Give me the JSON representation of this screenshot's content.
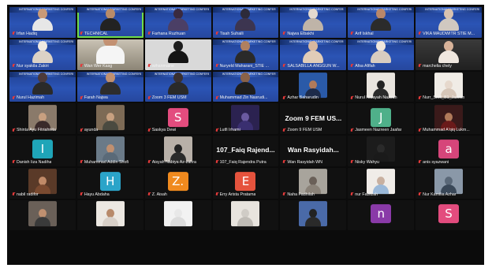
{
  "banner_text": "INTERNATIONAL MARKETING CONFERENCE 2024",
  "tiles": [
    {
      "name": "Irfan Hadiq",
      "kind": "person",
      "bg": "banner",
      "banner": true,
      "skin": "#c89a78",
      "shirt": "#e7e7e7"
    },
    {
      "name": "TECHNICAL",
      "kind": "person",
      "bg": "banner",
      "banner": true,
      "speaking": true,
      "skin": "#b88b69",
      "shirt": "#222"
    },
    {
      "name": "Farhana Ruzhuan",
      "kind": "person",
      "bg": "banner",
      "banner": true,
      "skin": "#3a2a40",
      "shirt": "#4b3f66"
    },
    {
      "name": "Tisah Suhaili",
      "kind": "person",
      "bg": "banner",
      "banner": true,
      "skin": "#2d2b3a",
      "shirt": "#3c3550"
    },
    {
      "name": "Najwa Elbakhi",
      "kind": "person",
      "bg": "banner",
      "banner": true,
      "skin": "#e3d9cf",
      "shirt": "#bfb4a8"
    },
    {
      "name": "Arif Iskhal",
      "kind": "person",
      "bg": "banner",
      "banner": true,
      "skin": "#b9876a",
      "shirt": "#2b2b2b"
    },
    {
      "name": "VIKA MAUDWITR STIE M...",
      "kind": "person",
      "bg": "banner",
      "banner": true,
      "skin": "#d8c2b0",
      "shirt": "#d0c8c0"
    },
    {
      "name": "Nur syakila Zakiri",
      "kind": "person",
      "bg": "banner",
      "banner": true,
      "skin": "#efe9e2",
      "shirt": "#dcd2c6"
    },
    {
      "name": "Wan Wer Kasg",
      "kind": "person",
      "bg": "room",
      "skin": "#c39172",
      "shirt": "#f5f5f5",
      "big": true
    },
    {
      "name": "wihanmaine",
      "kind": "person",
      "bg": "gray",
      "skin": "#1c1c1c",
      "shirt": "#141414"
    },
    {
      "name": "Nuryeld Maharani_STIE ...",
      "kind": "person",
      "bg": "banner",
      "banner": true,
      "skin": "#b08060",
      "shirt": "#2a2a2a"
    },
    {
      "name": "SALSABILLA ANGGUN W...",
      "kind": "person",
      "bg": "banner",
      "banner": true,
      "skin": "#d8b8a0",
      "shirt": "#e0ccb8"
    },
    {
      "name": "Afsa Afifah",
      "kind": "person",
      "bg": "banner",
      "banner": true,
      "skin": "#efe6dc",
      "shirt": "#d8ccc0"
    },
    {
      "name": "marchelia chely",
      "kind": "person",
      "bg": "wall",
      "skin": "#d8b39a",
      "shirt": "#efe7df"
    },
    {
      "name": "Nurul Hazimah",
      "kind": "person",
      "bg": "banner",
      "banner": true,
      "skin": "#4d3a3a",
      "shirt": "#2a2a2a"
    },
    {
      "name": "Farah Najwa",
      "kind": "person",
      "bg": "banner",
      "banner": true,
      "skin": "#c09070",
      "shirt": "#2d2d2d"
    },
    {
      "name": "Zoom 3 FEM USM",
      "kind": "person",
      "bg": "banner",
      "banner": true,
      "skin": "#3a3030",
      "shirt": "#2a2a2a"
    },
    {
      "name": "Muhammad Zin Nasrudi...",
      "kind": "person",
      "bg": "banner",
      "banner": true,
      "skin": "#8a6248",
      "shirt": "#1e1e1e"
    },
    {
      "name": "Azhar Baharudin",
      "kind": "photo",
      "bg": "dark",
      "pbg": "#2a5aa8",
      "skin": "#b07a5a",
      "shirt": "#1d2b4a"
    },
    {
      "name": "Nurul Hidayah Nazirah",
      "kind": "photo",
      "bg": "dark",
      "pbg": "#e8e4de",
      "skin": "#222",
      "shirt": "#2a2a2a"
    },
    {
      "name": "Nurr_Smff_B1_Jasmin",
      "kind": "photo",
      "bg": "dark",
      "pbg": "#f0ece6",
      "skin": "#e6d8cc",
      "shirt": "#d6c6b8"
    },
    {
      "name": "Shinta Ayu Fitriahnita",
      "kind": "photo",
      "bg": "dark",
      "pbg": "#8a7a6a",
      "skin": "#c8a080",
      "shirt": "#3a2a2a"
    },
    {
      "name": "ayunda",
      "kind": "photo",
      "bg": "dark",
      "pbg": "#7d6a55",
      "skin": "#c8a080",
      "shirt": "#4a4a40"
    },
    {
      "name": "Saskya Dewi",
      "kind": "avatar",
      "bg": "dark",
      "letter": "S",
      "color": "#e34c7e"
    },
    {
      "name": "Lutfi Irhami",
      "kind": "photo",
      "bg": "dark",
      "pbg": "#2b2250",
      "skin": "#6a5aa0",
      "shirt": "#3a2f70"
    },
    {
      "name": "Zoom 9 FEM USM",
      "kind": "bigname",
      "bg": "dark",
      "label": "Zoom 9 FEM US..."
    },
    {
      "name": "Jasmeen Nazreen Jaafar",
      "kind": "avatar",
      "bg": "dark",
      "letter": "J",
      "color": "#4fb08a"
    },
    {
      "name": "Muhammad A'qiq Lukm...",
      "kind": "photo",
      "bg": "dark",
      "pbg": "#3a1a1a",
      "skin": "#b07a5a",
      "shirt": "#6a1a1a"
    },
    {
      "name": "Danish Iiza Nadiha",
      "kind": "avatar",
      "bg": "dark",
      "letter": "I",
      "color": "#1fa5b8"
    },
    {
      "name": "Muhammad Addin Shofi",
      "kind": "photo",
      "bg": "dark",
      "pbg": "#6a7a88",
      "skin": "#c09070",
      "shirt": "#5a6a78"
    },
    {
      "name": "Aisyah Nabiya Az-zahra",
      "kind": "photo",
      "bg": "dark",
      "pbg": "#b8b0a8",
      "skin": "#222",
      "shirt": "#2a2a2a"
    },
    {
      "name": "107_Faiq Rajendra Putra",
      "kind": "bigname",
      "bg": "dark",
      "label": "107_Faiq Rajend..."
    },
    {
      "name": "Wan Rasyidah WN",
      "kind": "bigname",
      "bg": "dark",
      "label": "Wan Rasyidah..."
    },
    {
      "name": "Nisky Wahyu",
      "kind": "photo",
      "bg": "dark",
      "pbg": "#1c1c1c",
      "skin": "#2a2a2a",
      "shirt": "#1a1a1a"
    },
    {
      "name": "anis syazwani",
      "kind": "avatar",
      "bg": "dark",
      "letter": "a",
      "color": "#d6457a"
    },
    {
      "name": "nabil radifor",
      "kind": "photo",
      "bg": "dark",
      "pbg": "#5a3a28",
      "skin": "#c08a68",
      "shirt": "#7a4a30"
    },
    {
      "name": "Hayu Abdaha",
      "kind": "avatar",
      "bg": "dark",
      "letter": "H",
      "color": "#2ba4c9"
    },
    {
      "name": "Z. Aisah",
      "kind": "avatar",
      "bg": "dark",
      "letter": "Z.",
      "color": "#f08a1e"
    },
    {
      "name": "Erry Arista Pratama",
      "kind": "avatar",
      "bg": "dark",
      "letter": "E",
      "color": "#e5533d"
    },
    {
      "name": "Naha Fadhilah",
      "kind": "photo",
      "bg": "dark",
      "pbg": "#a8a49c",
      "skin": "#6a6058",
      "shirt": "#8a8278"
    },
    {
      "name": "nur Fazlizah",
      "kind": "photo",
      "bg": "dark",
      "pbg": "#f0ece8",
      "skin": "#c8b0a0",
      "shirt": "#9ab8d8"
    },
    {
      "name": "Nur Kamilia Azhar",
      "kind": "photo",
      "bg": "dark",
      "pbg": "#8a98a8",
      "skin": "#5a6878",
      "shirt": "#3a4858"
    },
    {
      "name": "",
      "kind": "photo",
      "bg": "dark",
      "pbg": "#6a6058",
      "skin": "#c09070",
      "shirt": "#3a3a3a"
    },
    {
      "name": "",
      "kind": "photo",
      "bg": "dark",
      "pbg": "#ece8e2",
      "skin": "#b88a6a",
      "shirt": "#d8d0c8"
    },
    {
      "name": "",
      "kind": "photo",
      "bg": "dark",
      "pbg": "#f2f2f2",
      "skin": "#e8e8e8",
      "shirt": "#dcdcdc"
    },
    {
      "name": "",
      "kind": "photo",
      "bg": "dark",
      "pbg": "#e8e4de",
      "skin": "#d0ccc6",
      "shirt": "#c0bcb6"
    },
    {
      "name": "",
      "kind": "photo",
      "bg": "dark",
      "pbg": "#4a6aa8",
      "skin": "#222",
      "shirt": "#2a2a2a"
    },
    {
      "name": "",
      "kind": "avatar",
      "bg": "dark",
      "letter": "n",
      "color": "#8a3aa8"
    },
    {
      "name": "",
      "kind": "avatar",
      "bg": "dark",
      "letter": "S",
      "color": "#e34c7e"
    }
  ]
}
